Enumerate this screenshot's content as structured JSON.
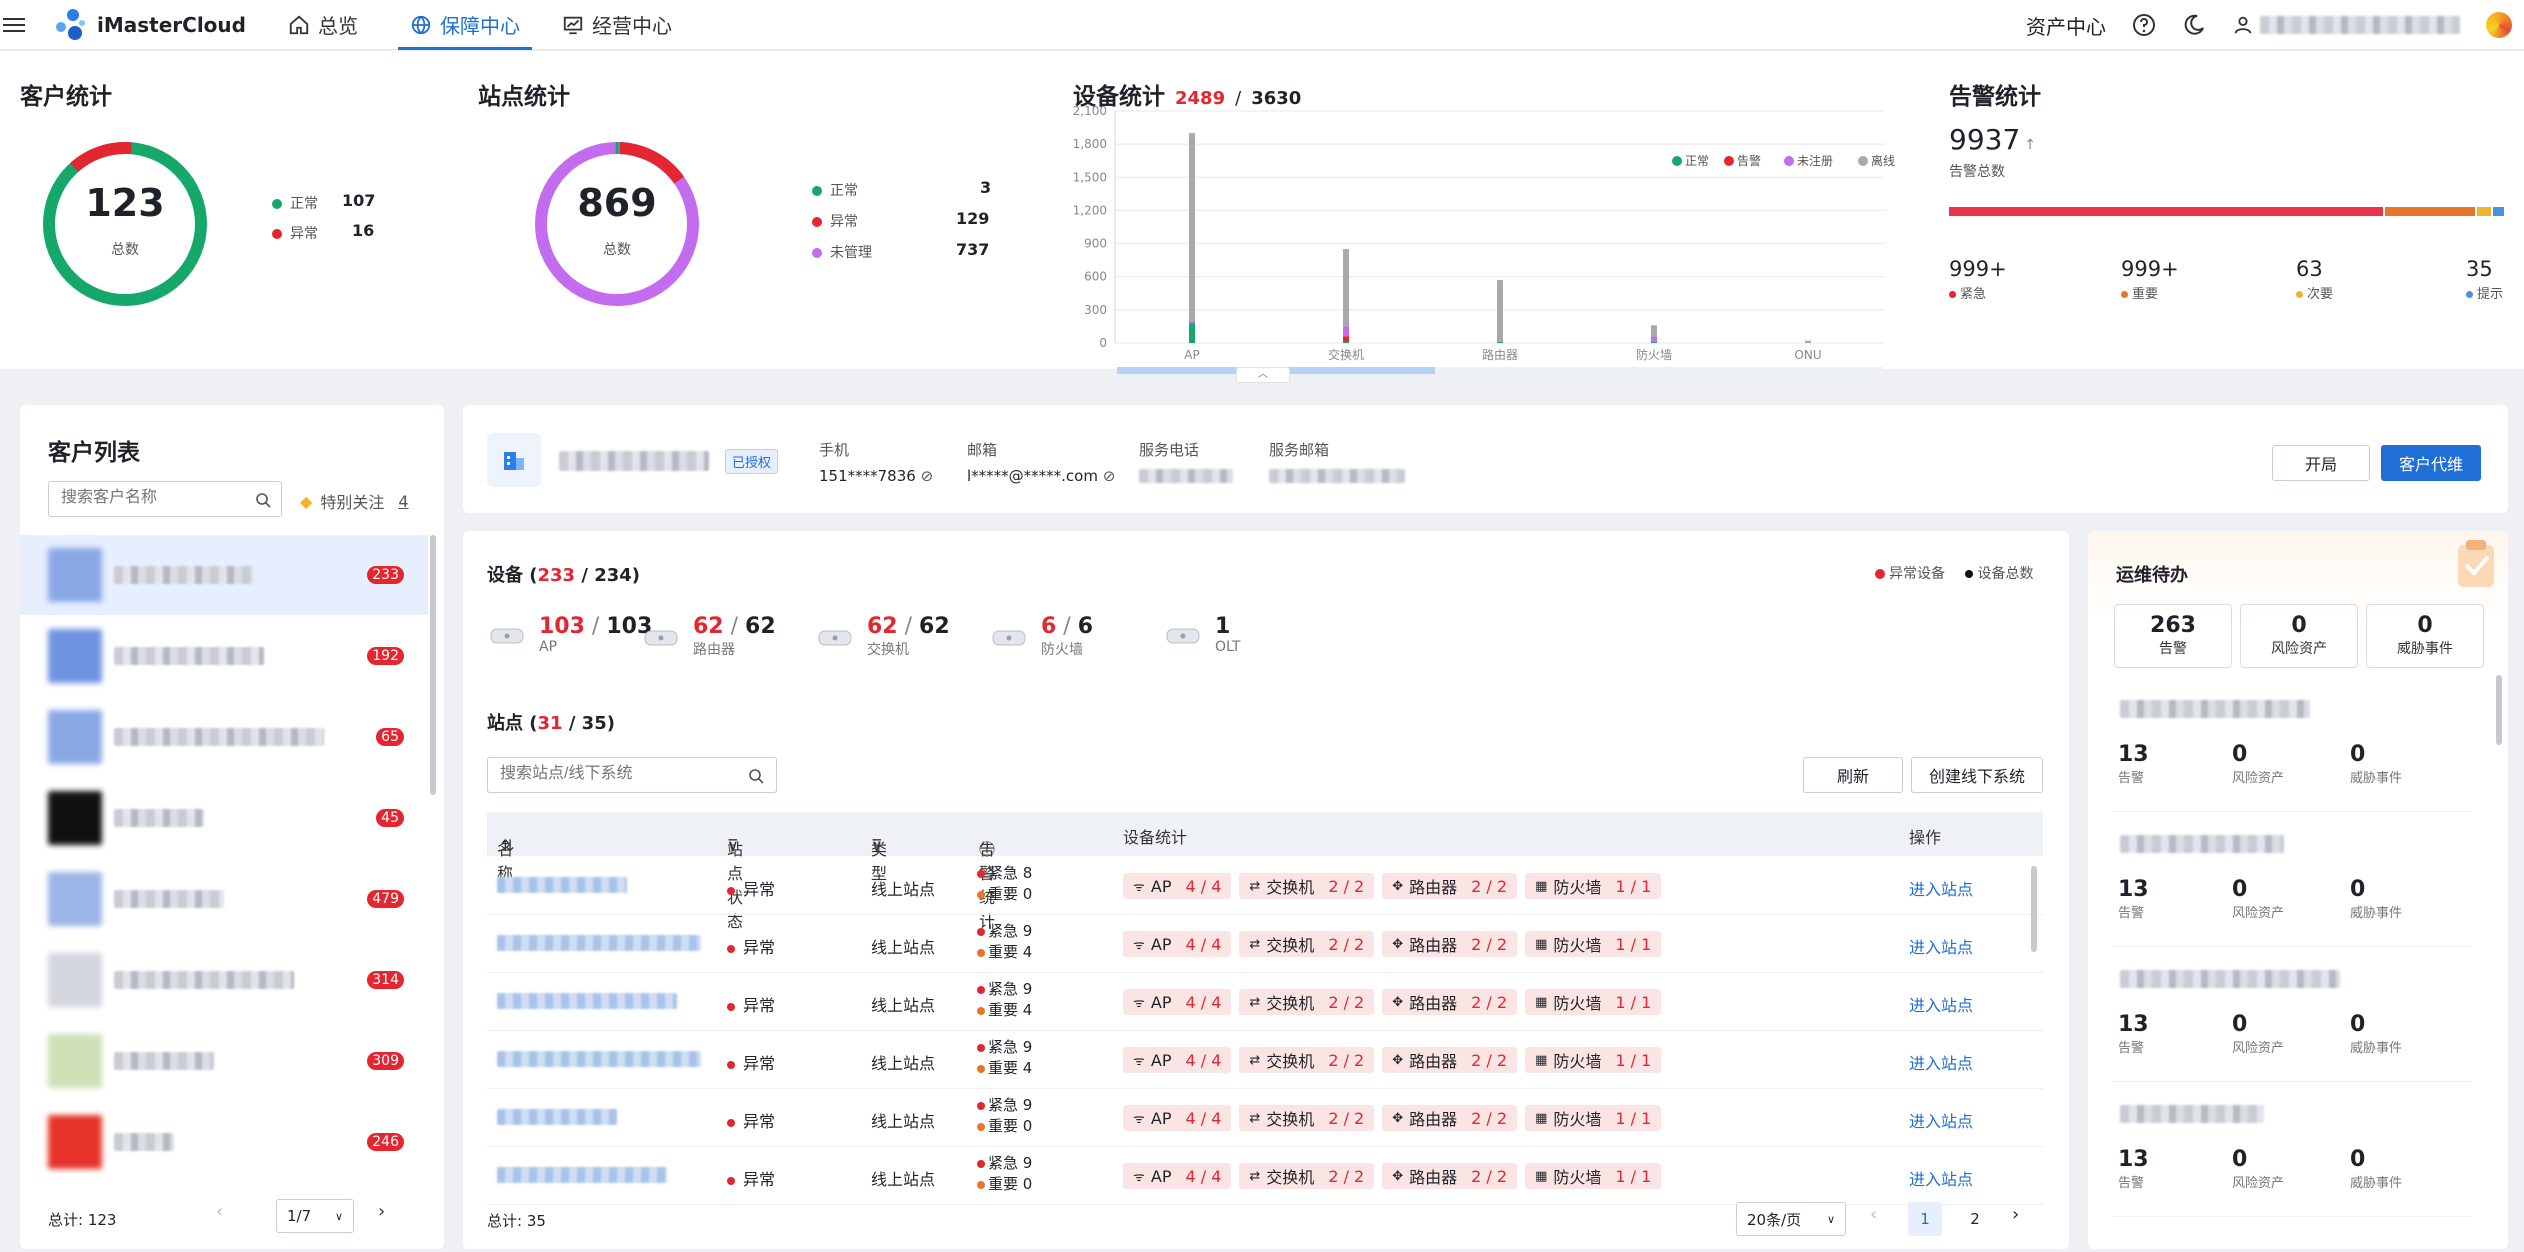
{
  "topbar": {
    "brand": "iMasterCloud",
    "tabs": [
      {
        "label": "总览"
      },
      {
        "label": "保障中心"
      },
      {
        "label": "经营中心"
      }
    ],
    "asset_center": "资产中心"
  },
  "customer_stats": {
    "title": "客户统计",
    "total": "123",
    "total_label": "总数",
    "legend": [
      {
        "label": "正常",
        "value": "107",
        "color": "#16a86b"
      },
      {
        "label": "异常",
        "value": "16",
        "color": "#e3262f"
      }
    ]
  },
  "site_stats": {
    "title": "站点统计",
    "total": "869",
    "total_label": "总数",
    "legend": [
      {
        "label": "正常",
        "value": "3",
        "color": "#16a86b"
      },
      {
        "label": "异常",
        "value": "129",
        "color": "#e3262f"
      },
      {
        "label": "未管理",
        "value": "737",
        "color": "#c46cf0"
      }
    ]
  },
  "device_stats": {
    "title": "设备统计",
    "abnormal": "2489",
    "sep": "/",
    "total": "3630",
    "chart_data": {
      "type": "bar",
      "stacked": true,
      "categories": [
        "AP",
        "交换机",
        "路由器",
        "防火墙",
        "ONU"
      ],
      "ylim": [
        0,
        2100
      ],
      "yticks": [
        "2,100",
        "1,800",
        "1,500",
        "1,200",
        "900",
        "600",
        "300",
        "0"
      ],
      "legend_position": "top-right",
      "series": [
        {
          "name": "正常",
          "color": "#16a86b",
          "values": [
            180,
            10,
            10,
            10,
            0
          ]
        },
        {
          "name": "告警",
          "color": "#e3262f",
          "values": [
            0,
            50,
            0,
            0,
            0
          ]
        },
        {
          "name": "未注册",
          "color": "#c46cf0",
          "values": [
            20,
            90,
            0,
            50,
            0
          ]
        },
        {
          "name": "离线",
          "color": "#a7a9ad",
          "values": [
            1700,
            700,
            560,
            100,
            20
          ]
        }
      ]
    }
  },
  "alarm_stats": {
    "title": "告警统计",
    "total": "9937",
    "total_label": "告警总数",
    "bar": [
      {
        "color": "#e8344a",
        "fraction": 0.775
      },
      {
        "color": "#e8762a",
        "fraction": 0.16
      },
      {
        "color": "#f0b429",
        "fraction": 0.025
      },
      {
        "color": "#4a90e2",
        "fraction": 0.02
      }
    ],
    "levels": [
      {
        "value": "999+",
        "label": "紧急",
        "color": "#e3262f"
      },
      {
        "value": "999+",
        "label": "重要",
        "color": "#e8762a"
      },
      {
        "value": "63",
        "label": "次要",
        "color": "#f0b429"
      },
      {
        "value": "35",
        "label": "提示",
        "color": "#4a90e2"
      }
    ]
  },
  "customer_list": {
    "title": "客户列表",
    "search_placeholder": "搜索客户名称",
    "special_label": "特别关注",
    "special_count": "4",
    "items": [
      {
        "badge": "233"
      },
      {
        "badge": "192"
      },
      {
        "badge": "65"
      },
      {
        "badge": "45"
      },
      {
        "badge": "479"
      },
      {
        "badge": "314"
      },
      {
        "badge": "309"
      },
      {
        "badge": "246"
      }
    ],
    "total": "总计: 123",
    "page": "1/7"
  },
  "customer_info": {
    "status_tag": "已授权",
    "phone_label": "手机",
    "phone": "151****7836",
    "email_label": "邮箱",
    "email": "l*****@*****.com",
    "service_phone_label": "服务电话",
    "service_email_label": "服务邮箱",
    "btn_open": "开局",
    "btn_proxy": "客户代维"
  },
  "devices": {
    "title": "设备",
    "abnormal": "233",
    "total": "234",
    "legend_abnormal": "异常设备",
    "legend_total": "设备总数",
    "items": [
      {
        "abnormal": "103",
        "total": "103",
        "label": "AP"
      },
      {
        "abnormal": "62",
        "total": "62",
        "label": "路由器"
      },
      {
        "abnormal": "62",
        "total": "62",
        "label": "交换机"
      },
      {
        "abnormal": "6",
        "total": "6",
        "label": "防火墙"
      },
      {
        "abnormal": "",
        "total": "1",
        "label": "OLT"
      }
    ]
  },
  "sites": {
    "title": "站点",
    "abnormal": "31",
    "total": "35",
    "search_placeholder": "搜索站点/线下系统",
    "btn_refresh": "刷新",
    "btn_create": "创建线下系统",
    "columns": [
      "名称",
      "站点状态",
      "类型",
      "告警统计",
      "设备统计",
      "操作"
    ],
    "rows": [
      {
        "status": "异常",
        "type": "线上站点",
        "urgent": "紧急 8",
        "major": "重要 0",
        "action": "进入站点"
      },
      {
        "status": "异常",
        "type": "线上站点",
        "urgent": "紧急 9",
        "major": "重要 4",
        "action": "进入站点"
      },
      {
        "status": "异常",
        "type": "线上站点",
        "urgent": "紧急 9",
        "major": "重要 4",
        "action": "进入站点"
      },
      {
        "status": "异常",
        "type": "线上站点",
        "urgent": "紧急 9",
        "major": "重要 4",
        "action": "进入站点"
      },
      {
        "status": "异常",
        "type": "线上站点",
        "urgent": "紧急 9",
        "major": "重要 0",
        "action": "进入站点"
      },
      {
        "status": "异常",
        "type": "线上站点",
        "urgent": "紧急 9",
        "major": "重要 0",
        "action": "进入站点"
      }
    ],
    "pills": [
      {
        "icon": "ᯤ",
        "label": "AP",
        "value": "4 / 4"
      },
      {
        "icon": "⇄",
        "label": "交换机",
        "value": "2 / 2"
      },
      {
        "icon": "✥",
        "label": "路由器",
        "value": "2 / 2"
      },
      {
        "icon": "▦",
        "label": "防火墙",
        "value": "1 / 1"
      }
    ],
    "footer_total": "总计: 35",
    "page_size": "20条/页",
    "pages": [
      "1",
      "2"
    ]
  },
  "ops": {
    "title": "运维待办",
    "cards": [
      {
        "value": "263",
        "label": "告警"
      },
      {
        "value": "0",
        "label": "风险资产"
      },
      {
        "value": "0",
        "label": "威胁事件"
      }
    ],
    "items": [
      {
        "alarm": "13",
        "risk": "0",
        "threat": "0"
      },
      {
        "alarm": "13",
        "risk": "0",
        "threat": "0"
      },
      {
        "alarm": "13",
        "risk": "0",
        "threat": "0"
      },
      {
        "alarm": "13",
        "risk": "0",
        "threat": "0"
      }
    ],
    "labels": {
      "alarm": "告警",
      "risk": "风险资产",
      "threat": "威胁事件"
    }
  }
}
